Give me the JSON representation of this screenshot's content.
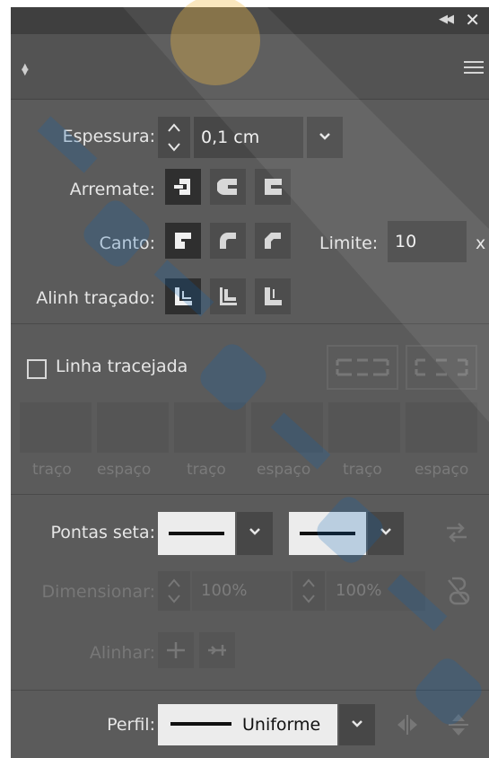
{
  "colors": {
    "panel": "#5b5b5b",
    "titlebar": "#3f3f3f",
    "label": "#e6e6e6",
    "selected_button": "#2f2f2f",
    "disabled_text": "#777777"
  },
  "labels": {
    "thickness": "Espessura:",
    "cap": "Arremate:",
    "corner": "Canto:",
    "limit": "Limite:",
    "align_stroke": "Alinh traçado:",
    "dashed_line": "Linha tracejada",
    "arrowheads": "Pontas seta:",
    "scale": "Dimensionar:",
    "align": "Alinhar:",
    "profile": "Perfil:"
  },
  "thickness_value": "0,1 cm",
  "limit_value": "10",
  "limit_suffix": "x",
  "dashed_line_checked": false,
  "dash_fields": [
    "traço",
    "espaço",
    "traço",
    "espaço",
    "traço",
    "espaço"
  ],
  "scale_values": [
    "100%",
    "100%"
  ],
  "profile_value": "Uniforme",
  "icons": [
    "collapse-arrows-icon",
    "close-icon",
    "panel-toggle-icon",
    "panel-menu-icon",
    "stepper-icon",
    "chevron-down-icon",
    "butt-cap-icon",
    "round-cap-icon",
    "projecting-cap-icon",
    "miter-join-icon",
    "round-join-icon",
    "bevel-join-icon",
    "align-center-icon",
    "align-inside-icon",
    "align-outside-icon",
    "dash-preserve-icon",
    "dash-align-icon",
    "swap-arrows-icon",
    "link-scale-icon",
    "flip-axis-icon",
    "flip-profile-icon"
  ]
}
